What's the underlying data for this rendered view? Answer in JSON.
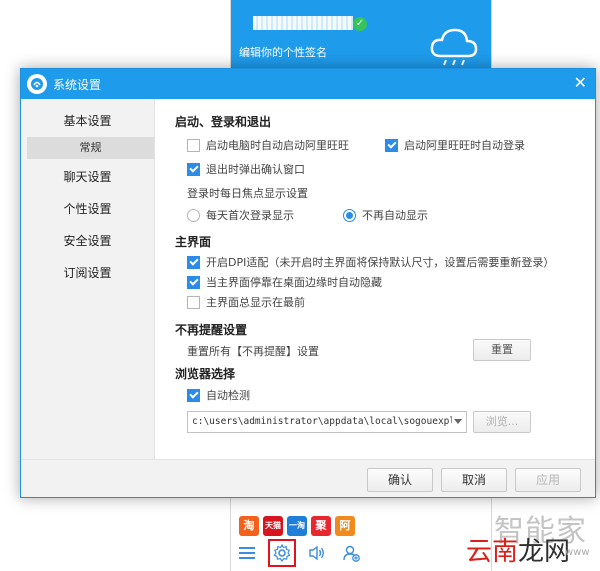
{
  "background_window": {
    "signature": "编辑你的个性签名",
    "apps": [
      {
        "icon": "taobao-icon",
        "glyph": "淘",
        "color": "#f2621c"
      },
      {
        "icon": "tmall-icon",
        "glyph": "天猫",
        "color": "#d8141e"
      },
      {
        "icon": "yitao-icon",
        "glyph": "一淘",
        "color": "#1e7ed8"
      },
      {
        "icon": "juhuasuan-icon",
        "glyph": "聚",
        "color": "#e8262f"
      },
      {
        "icon": "alibaba-icon",
        "glyph": "阿",
        "color": "#f08a1c"
      }
    ]
  },
  "dialog": {
    "title": "系统设置",
    "close_glyph": "✕",
    "nav": [
      {
        "label": "基本设置",
        "name": "nav-basic-settings"
      },
      {
        "label": "常规",
        "name": "nav-general",
        "sub": true
      },
      {
        "label": "聊天设置",
        "name": "nav-chat-settings"
      },
      {
        "label": "个性设置",
        "name": "nav-personal-settings"
      },
      {
        "label": "安全设置",
        "name": "nav-security-settings"
      },
      {
        "label": "订阅设置",
        "name": "nav-subscription-settings"
      }
    ],
    "sections": {
      "startup": {
        "title": "启动、登录和退出",
        "auto_start": "启动电脑时自动启动阿里旺旺",
        "auto_login": "启动阿里旺旺时自动登录",
        "exit_confirm": "退出时弹出确认窗口",
        "focus_label": "登录时每日焦点显示设置",
        "radio_first_login": "每天首次登录显示",
        "radio_no_auto": "不再自动显示"
      },
      "main_ui": {
        "title": "主界面",
        "dpi": "开启DPI适配（未开启时主界面将保持默认尺寸，设置后需要重新登录）",
        "auto_hide": "当主界面停靠在桌面边缘时自动隐藏",
        "always_top": "主界面总显示在最前"
      },
      "reminders": {
        "title": "不再提醒设置",
        "reset_text": "重置所有【不再提醒】设置",
        "reset_button": "重置"
      },
      "browser": {
        "title": "浏览器选择",
        "auto_detect": "自动检测",
        "path": "c:\\users\\administrator\\appdata\\local\\sogouexpl",
        "browse_button": "浏览..."
      }
    },
    "footer": {
      "ok": "确认",
      "cancel": "取消",
      "apply": "应用"
    }
  },
  "watermark": {
    "line1": "智能家",
    "line2_red": "云南",
    "line2_black": "龙网",
    "line3": "www"
  }
}
